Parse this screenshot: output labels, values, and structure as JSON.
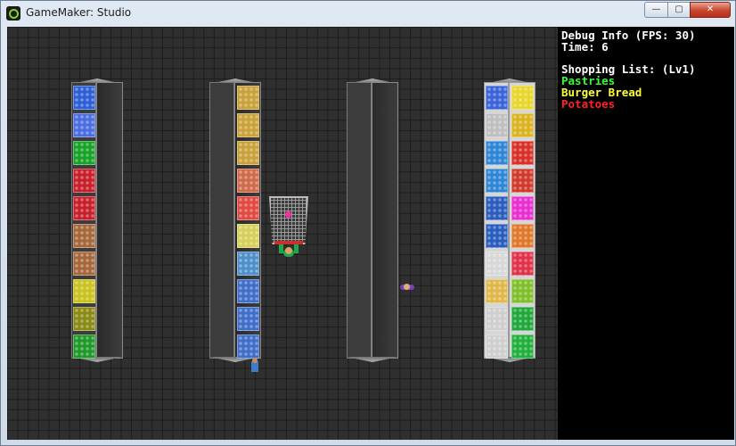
{
  "window": {
    "title": "GameMaker: Studio",
    "controls": {
      "minimize": "—",
      "maximize": "▢",
      "close": "✕"
    }
  },
  "debug": {
    "line1": "Debug Info (FPS: 30)",
    "line2": "Time: 6"
  },
  "shopping_list": {
    "header": "Shopping List: (Lv1)",
    "items": [
      {
        "name": "Pastries",
        "color": "#33ff33"
      },
      {
        "name": "Burger Bread",
        "color": "#ffff33"
      },
      {
        "name": "Potatoes",
        "color": "#ff2222"
      }
    ]
  },
  "shelves": [
    {
      "name": "aisle-1",
      "style": "dark",
      "products": [
        "#2f5fd6",
        "#4a6ee0",
        "#17a327",
        "#c81f2a",
        "#c81f2a",
        "#a6683a",
        "#a6683a",
        "#c9c21f",
        "#8a8a14",
        "#1f9a2a"
      ]
    },
    {
      "name": "aisle-2",
      "style": "dark",
      "products": [
        "#c9a23a",
        "#c9a23a",
        "#c9a23a",
        "#d06a4a",
        "#e04a40",
        "#d7cf59",
        "#4f8fc9",
        "#3f6fc9",
        "#3f6fc9",
        "#3f6fc9"
      ]
    },
    {
      "name": "aisle-3",
      "style": "dark",
      "products": []
    },
    {
      "name": "aisle-4",
      "style": "white",
      "products": [
        [
          "#3a64d8",
          "#e8d62a"
        ],
        [
          "#bfbfbf",
          "#d9b320"
        ],
        [
          "#2f86d6",
          "#d8312a"
        ],
        [
          "#2f86d6",
          "#cf3a2c"
        ],
        [
          "#2b5dbf",
          "#e82fcf"
        ],
        [
          "#2b5dbf",
          "#e0782a"
        ],
        [
          "#d8d8d8",
          "#e0324a"
        ],
        [
          "#e0b84a",
          "#7fbf2a"
        ],
        [
          "#cfcfcf",
          "#20a83a"
        ],
        [
          "#cfcfcf",
          "#22b03c"
        ]
      ]
    }
  ]
}
